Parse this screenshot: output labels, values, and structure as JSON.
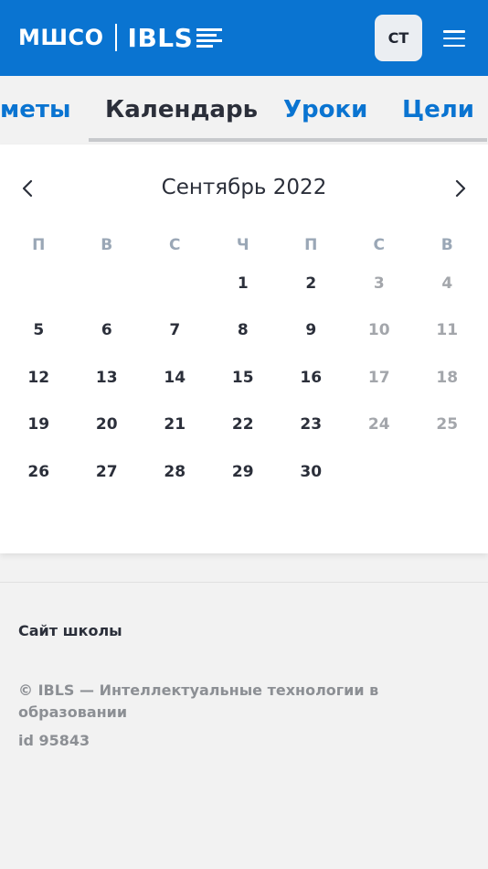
{
  "header": {
    "logo_part1": "МШСО",
    "logo_part2": "IBLS",
    "avatar_initials": "СТ",
    "menu_icon": "hamburger-icon",
    "brand_color": "#0a74d1"
  },
  "tabs": [
    {
      "label": "меты",
      "active": false
    },
    {
      "label": "Календарь",
      "active": true
    },
    {
      "label": "Уроки",
      "active": false
    },
    {
      "label": "Цели",
      "active": false
    }
  ],
  "calendar": {
    "month_title": "Сентябрь 2022",
    "prev_icon": "chevron-left-icon",
    "next_icon": "chevron-right-icon",
    "weekdays": [
      "П",
      "В",
      "С",
      "Ч",
      "П",
      "С",
      "В"
    ],
    "weeks": [
      [
        "",
        "",
        "",
        "1",
        "2",
        "3",
        "4"
      ],
      [
        "5",
        "6",
        "7",
        "8",
        "9",
        "10",
        "11"
      ],
      [
        "12",
        "13",
        "14",
        "15",
        "16",
        "17",
        "18"
      ],
      [
        "19",
        "20",
        "21",
        "22",
        "23",
        "24",
        "25"
      ],
      [
        "26",
        "27",
        "28",
        "29",
        "30",
        "",
        ""
      ]
    ]
  },
  "footer": {
    "school_link": "Сайт школы",
    "copyright": "© IBLS — Интеллектуальные технологии в образовании",
    "id_text": "id 95843"
  }
}
